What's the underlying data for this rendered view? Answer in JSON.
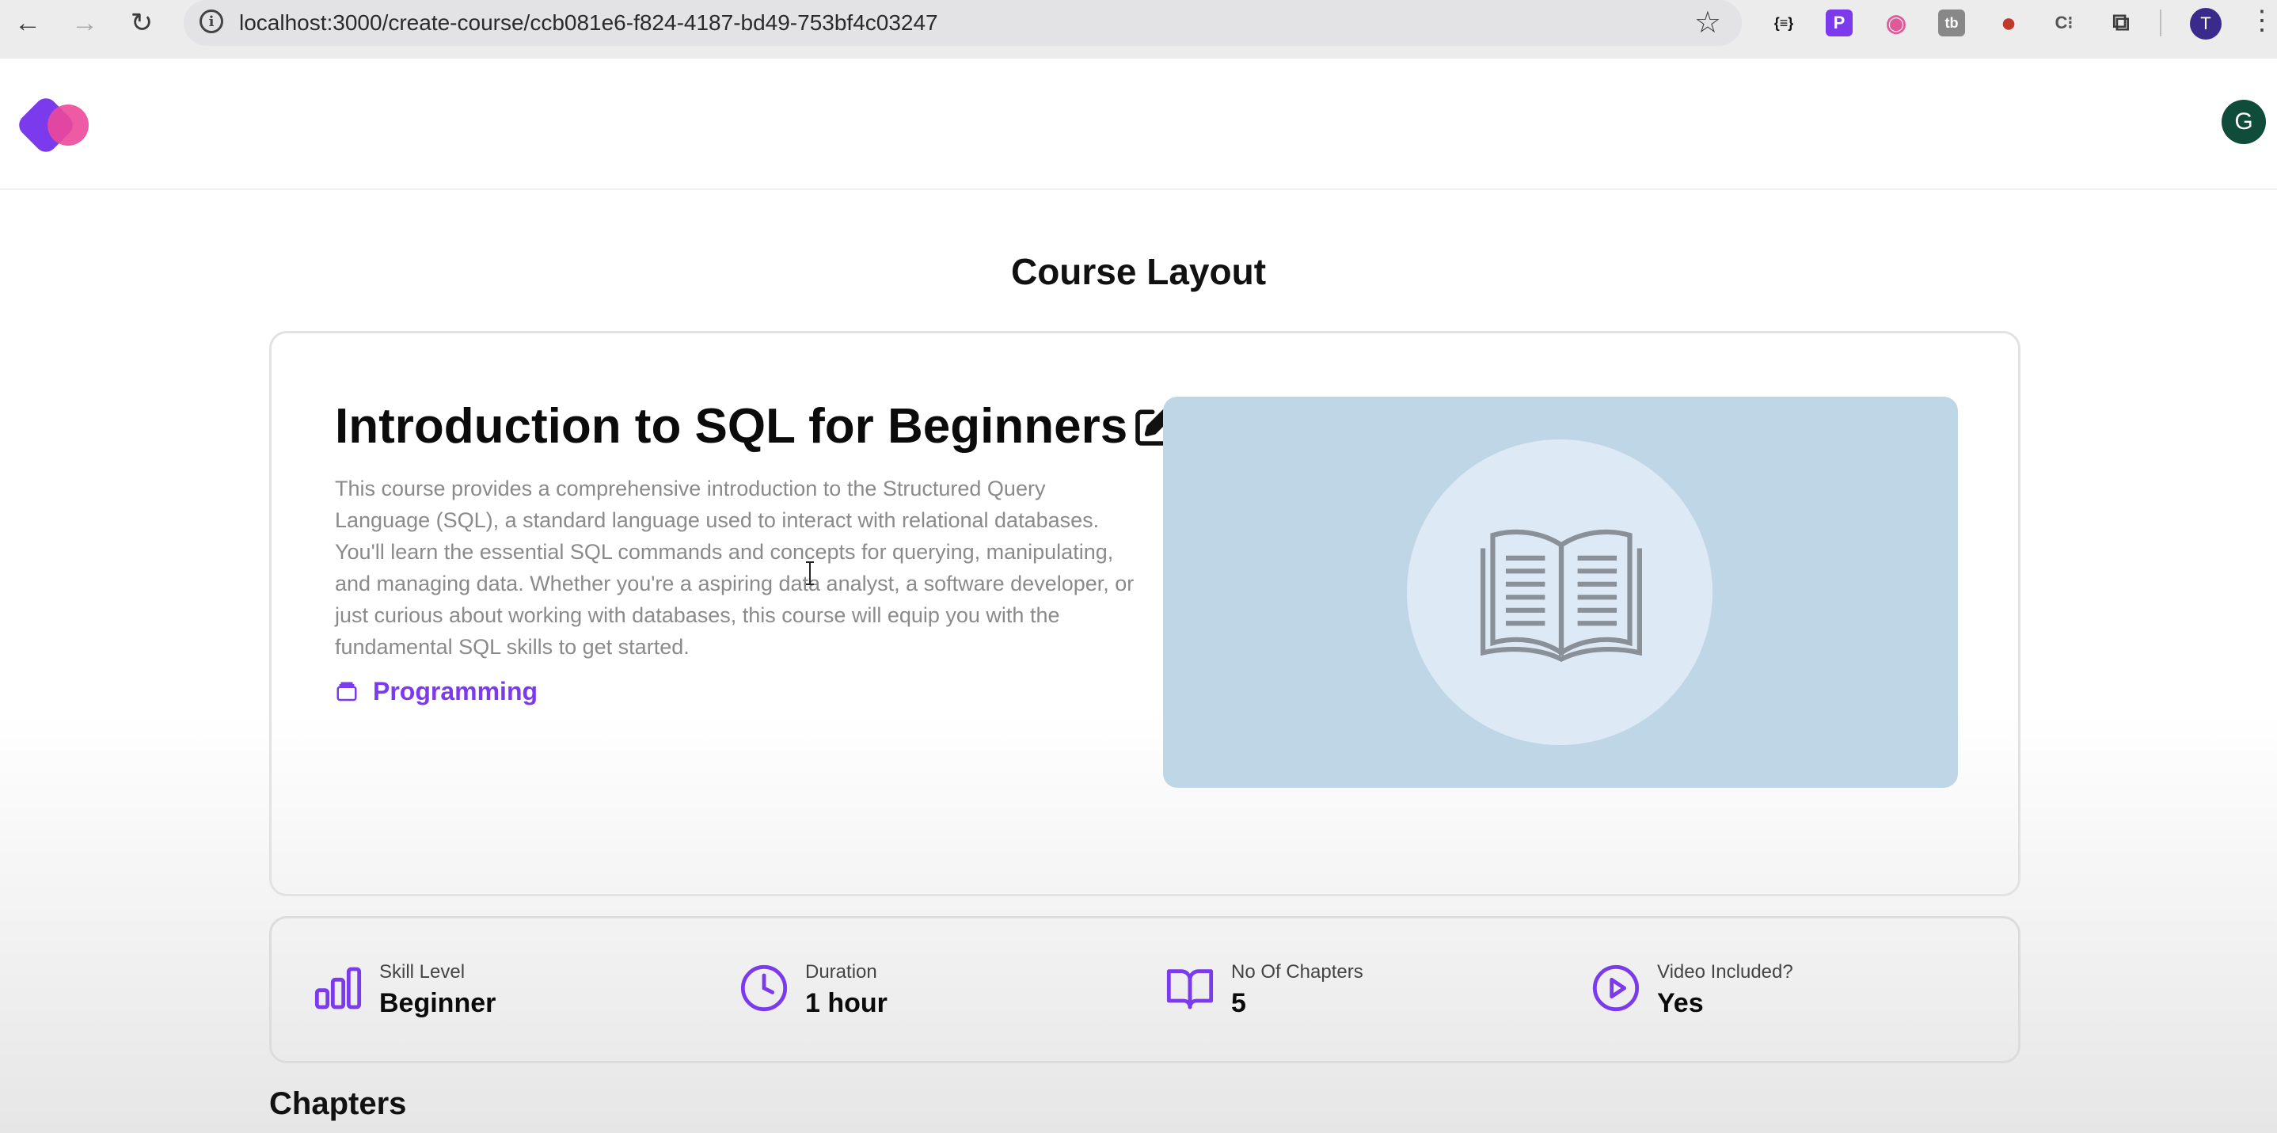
{
  "browser": {
    "url": "localhost:3000/create-course/ccb081e6-f824-4187-bd49-753bf4c03247",
    "extensions": [
      {
        "name": "json-viewer-icon",
        "glyph": "{≡}",
        "color": "#3c3c3c"
      },
      {
        "name": "purple-p-extension-icon",
        "glyph": "P",
        "color": "#7c3aed"
      },
      {
        "name": "color-picker-icon",
        "glyph": "◉",
        "color": "#e05a9a"
      },
      {
        "name": "tb-extension-icon",
        "glyph": "tb",
        "color": "#666666"
      },
      {
        "name": "red-extension-icon",
        "glyph": "●",
        "color": "#c0392b"
      },
      {
        "name": "c-extension-icon",
        "glyph": "C⁝",
        "color": "#555555"
      },
      {
        "name": "extensions-puzzle-icon",
        "glyph": "⧉",
        "color": "#3c3c3c"
      }
    ],
    "profile_initial": "T"
  },
  "header": {
    "user_initial": "G"
  },
  "page": {
    "title": "Course Layout"
  },
  "course": {
    "title": "Introduction to SQL for Beginners",
    "description": "This course provides a comprehensive introduction to the Structured Query Language (SQL), a standard language used to interact with relational databases. You'll learn the essential SQL commands and concepts for querying, manipulating, and managing data. Whether you're a aspiring data analyst, a software developer, or just curious about working with databases, this course will equip you with the fundamental SQL skills to get started.",
    "category": "Programming"
  },
  "stats": [
    {
      "label": "Skill Level",
      "value": "Beginner",
      "icon": "bar-chart-icon"
    },
    {
      "label": "Duration",
      "value": "1 hour",
      "icon": "clock-icon"
    },
    {
      "label": "No Of Chapters",
      "value": "5",
      "icon": "book-open-icon"
    },
    {
      "label": "Video Included?",
      "value": "Yes",
      "icon": "play-circle-icon"
    }
  ],
  "chapters": {
    "heading": "Chapters"
  },
  "colors": {
    "accent": "#7c3aed",
    "brand_pink": "#ec4899",
    "image_bg": "#bfd6e6"
  }
}
